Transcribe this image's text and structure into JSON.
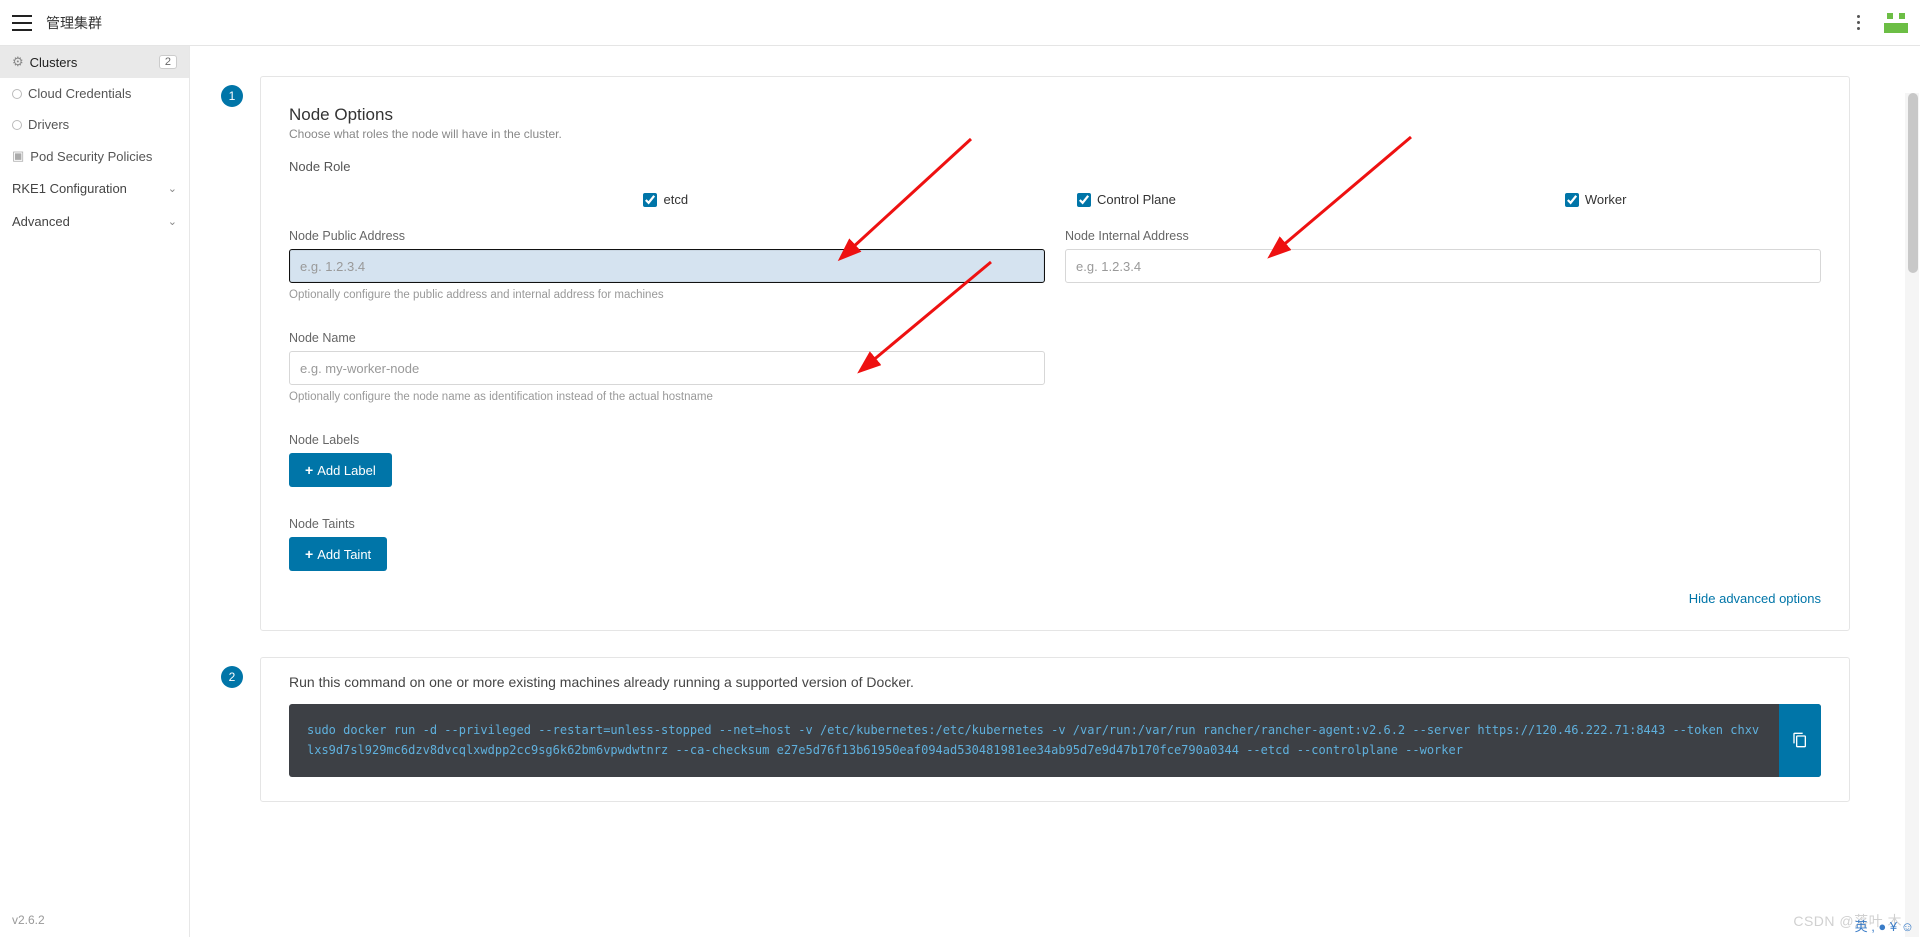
{
  "topbar": {
    "title": "管理集群"
  },
  "sidebar": {
    "clusters": {
      "label": "Clusters",
      "count": "2"
    },
    "cloud_credentials": "Cloud Credentials",
    "drivers": "Drivers",
    "psp": "Pod Security Policies",
    "rke1": "RKE1 Configuration",
    "advanced": "Advanced",
    "version": "v2.6.2"
  },
  "step1": {
    "num": "1",
    "title": "Node Options",
    "subtitle": "Choose what roles the node will have in the cluster.",
    "node_role_label": "Node Role",
    "roles": {
      "etcd": "etcd",
      "control_plane": "Control Plane",
      "worker": "Worker"
    },
    "public_address": {
      "label": "Node Public Address",
      "placeholder": "e.g. 1.2.3.4",
      "hint": "Optionally configure the public address and internal address for machines"
    },
    "internal_address": {
      "label": "Node Internal Address",
      "placeholder": "e.g. 1.2.3.4"
    },
    "node_name": {
      "label": "Node Name",
      "placeholder": "e.g. my-worker-node",
      "hint": "Optionally configure the node name as identification instead of the actual hostname"
    },
    "labels": {
      "label": "Node Labels",
      "button": "Add Label"
    },
    "taints": {
      "label": "Node Taints",
      "button": "Add Taint"
    },
    "hide_advanced": "Hide advanced options"
  },
  "step2": {
    "num": "2",
    "text": "Run this command on one or more existing machines already running a supported version of Docker.",
    "command": "sudo docker run -d --privileged --restart=unless-stopped --net=host -v /etc/kubernetes:/etc/kubernetes -v /var/run:/var/run  rancher/rancher-agent:v2.6.2 --server https://120.46.222.71:8443 --token chxvlxs9d7sl929mc6dzv8dvcqlxwdpp2cc9sg6k62bm6vpwdwtnrz --ca-checksum e27e5d76f13b61950eaf094ad530481981ee34ab95d7e9d47b170fce790a0344 --etcd --controlplane --worker"
  },
  "watermark": "CSDN @落叶   木",
  "ime": "英 , ● ¥ ☺"
}
